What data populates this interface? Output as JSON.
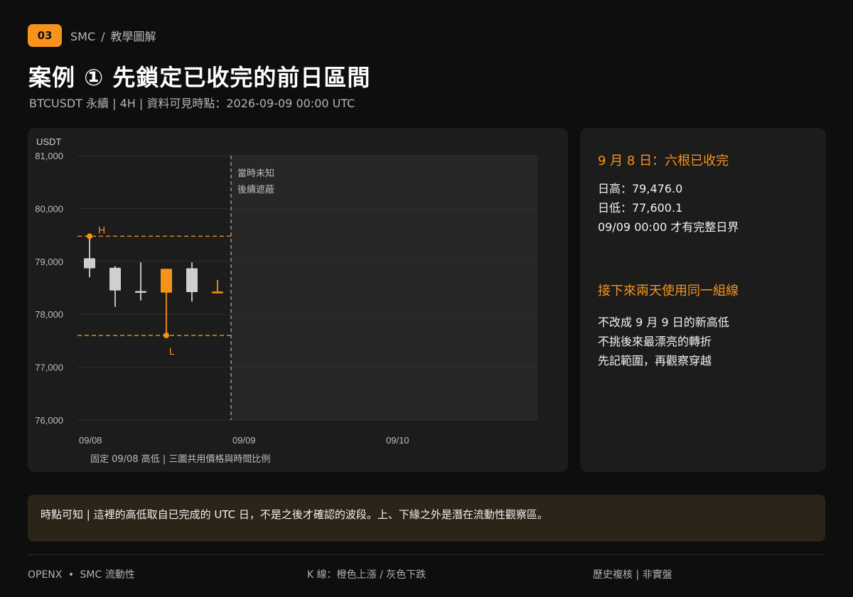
{
  "header": {
    "step_number": "03",
    "breadcrumb_section": "SMC",
    "breadcrumb_separator": "/",
    "breadcrumb_page": "教學圖解",
    "title": "案例 ① 先鎖定已收完的前日區間",
    "subtitle": "BTCUSDT 永續 | 4H | 資料可見時點：2026-09-09 00:00 UTC"
  },
  "chart_data": {
    "type": "candlestick",
    "y_unit_label": "USDT",
    "ylim": [
      76000,
      81000
    ],
    "y_ticks": [
      81000,
      80000,
      79000,
      78000,
      77000,
      76000
    ],
    "y_tick_labels": [
      "81,000",
      "80,000",
      "79,000",
      "78,000",
      "77,000",
      "76,000"
    ],
    "x_tick_labels": [
      "09/08",
      "09/09",
      "09/10"
    ],
    "grid": true,
    "candle_timeframe": "4H",
    "candles": [
      {
        "index": 0,
        "open": 79060,
        "close": 78870,
        "high": 79476,
        "low": 78700,
        "color": "gray"
      },
      {
        "index": 1,
        "open": 78880,
        "close": 78450,
        "high": 78910,
        "low": 78140,
        "color": "gray"
      },
      {
        "index": 2,
        "open": 78440,
        "close": 78410,
        "high": 78980,
        "low": 78260,
        "color": "gray"
      },
      {
        "index": 3,
        "open": 78410,
        "close": 78860,
        "high": 78860,
        "low": 77600.1,
        "color": "orange"
      },
      {
        "index": 4,
        "open": 78870,
        "close": 78420,
        "high": 78980,
        "low": 78240,
        "color": "gray"
      },
      {
        "index": 5,
        "open": 78410,
        "close": 78430,
        "high": 78650,
        "low": 78410,
        "color": "orange"
      }
    ],
    "day_high": {
      "value": 79476.0,
      "label": "H"
    },
    "day_low": {
      "value": 77600.1,
      "label": "L"
    },
    "masked_region_label_line1": "當時未知",
    "masked_region_label_line2": "後續遮蔽",
    "caption": "固定 09/08 高低 | 三圖共用價格與時間比例",
    "colors": {
      "up": "#f7931a",
      "down": "#cfcfcf",
      "level_line": "#f7931a",
      "masked": "#272727"
    }
  },
  "side_panel": {
    "heading1": "9 月 8 日：六根已收完",
    "lines1": [
      "日高：79,476.0",
      "日低：77,600.1",
      "09/09 00:00 才有完整日界"
    ],
    "heading2": "接下來兩天使用同一組線",
    "lines2": [
      "不改成 9 月 9 日的新高低",
      "不挑後來最漂亮的轉折",
      "先記範圍，再觀察穿越"
    ]
  },
  "note": "時點可知 | 這裡的高低取自已完成的 UTC 日，不是之後才確認的波段。上、下緣之外是潛在流動性觀察區。",
  "footer": {
    "brand": "OPENX",
    "dot": "•",
    "brand_suffix": "SMC 流動性",
    "legend": "K 線：橙色上漲 / 灰色下跌",
    "disclaimer": "歷史複核 | 非實盤"
  },
  "theme": {
    "accent": "#f7931a",
    "background": "#0e0e0e",
    "card": "#1c1c1c",
    "note_background": "#2b2418"
  }
}
